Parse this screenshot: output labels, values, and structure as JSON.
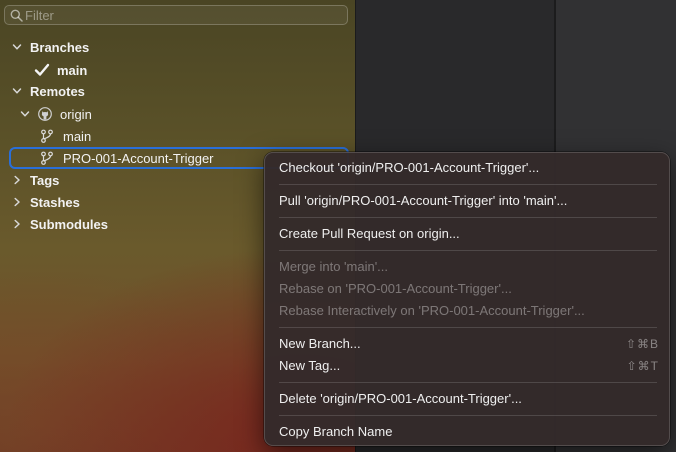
{
  "sidebar": {
    "filter_placeholder": "Filter",
    "sections": {
      "branches": "Branches",
      "remotes": "Remotes",
      "tags": "Tags",
      "stashes": "Stashes",
      "submodules": "Submodules"
    },
    "local_branch": "main",
    "remote_name": "origin",
    "remote_branches": [
      "main",
      "PRO-001-Account-Trigger"
    ]
  },
  "context_menu": {
    "items": [
      {
        "label": "Checkout 'origin/PRO-001-Account-Trigger'...",
        "enabled": true
      },
      {
        "label": "Pull 'origin/PRO-001-Account-Trigger' into 'main'...",
        "enabled": true
      },
      {
        "label": "Create Pull Request on origin...",
        "enabled": true
      },
      {
        "label": "Merge into 'main'...",
        "enabled": false
      },
      {
        "label": "Rebase on 'PRO-001-Account-Trigger'...",
        "enabled": false
      },
      {
        "label": "Rebase Interactively on 'PRO-001-Account-Trigger'...",
        "enabled": false
      },
      {
        "label": "New Branch...",
        "enabled": true,
        "shortcut": "⇧⌘B"
      },
      {
        "label": "New Tag...",
        "enabled": true,
        "shortcut": "⇧⌘T"
      },
      {
        "label": "Delete 'origin/PRO-001-Account-Trigger'...",
        "enabled": true
      },
      {
        "label": "Copy Branch Name",
        "enabled": true
      }
    ]
  },
  "colors": {
    "selection_border": "#2a6fd8",
    "menu_background": "#342a2a",
    "text": "#f2f2f2",
    "disabled_text": "#8a8080"
  },
  "icons": {
    "filter": "magnifier-icon",
    "expanded": "chevron-down-icon",
    "collapsed": "chevron-right-icon",
    "current_branch": "checkmark-icon",
    "remote": "github-icon",
    "branch": "git-branch-icon"
  }
}
